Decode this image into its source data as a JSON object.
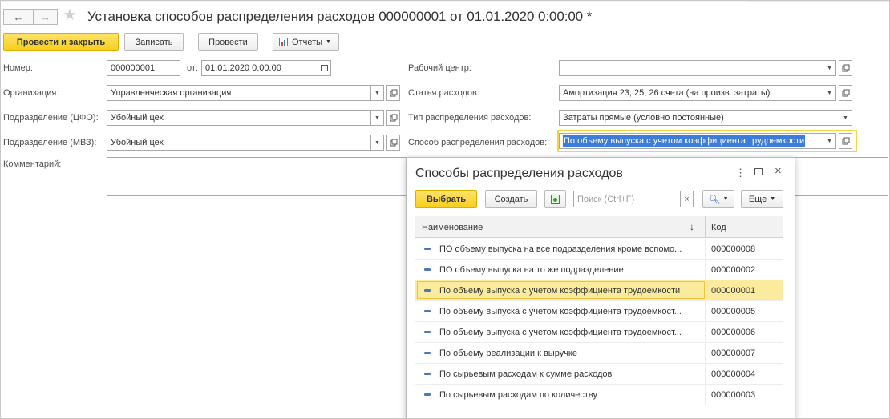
{
  "window": {
    "title": "Установка способов распределения расходов 000000001 от 01.01.2020 0:00:00 *"
  },
  "nav": {
    "back_icon": "←",
    "forward_icon": "→",
    "star_icon": "★"
  },
  "toolbar": {
    "post_close": "Провести и закрыть",
    "save": "Записать",
    "post": "Провести",
    "reports": "Отчеты"
  },
  "form": {
    "number_label": "Номер:",
    "number_value": "000000001",
    "date_label": "от:",
    "date_value": "01.01.2020  0:00:00",
    "org_label": "Организация:",
    "org_value": "Управленческая организация",
    "cfo_label": "Подразделение (ЦФО):",
    "cfo_value": "Убойный цех",
    "mvz_label": "Подразделение (МВЗ):",
    "mvz_value": "Убойный цех",
    "comment_label": "Комментарий:",
    "comment_value": "",
    "workcenter_label": "Рабочий центр:",
    "workcenter_value": "",
    "expense_item_label": "Статья расходов:",
    "expense_item_value": "Амортизация 23, 25, 26 счета (на произв. затраты)",
    "dist_type_label": "Тип распределения расходов:",
    "dist_type_value": "Затраты прямые (условно постоянные)",
    "dist_method_label": "Способ распределения расходов:",
    "dist_method_value": "По объему выпуска с учетом коэффициента трудоемкости"
  },
  "popup": {
    "title": "Способы распределения расходов",
    "select": "Выбрать",
    "create": "Создать",
    "search_placeholder": "Поиск (Ctrl+F)",
    "more": "Еще",
    "col_name": "Наименование",
    "col_code": "Код",
    "rows": [
      {
        "name": "ПО объему выпуска на все подразделения кроме вспомо...",
        "code": "000000008"
      },
      {
        "name": "ПО объему выпуска на то же подразделение",
        "code": "000000002"
      },
      {
        "name": "По объему выпуска с учетом коэффициента трудоемкости",
        "code": "000000001"
      },
      {
        "name": "По объему выпуска с учетом коэффициента трудоемкост...",
        "code": "000000005"
      },
      {
        "name": "По объему выпуска с учетом коэффициента трудоемкост...",
        "code": "000000006"
      },
      {
        "name": "По объему реализации к выручке",
        "code": "000000007"
      },
      {
        "name": "По сырьевым расходам к сумме расходов",
        "code": "000000004"
      },
      {
        "name": "По сырьевым расходам по количеству",
        "code": "000000003"
      }
    ]
  },
  "colors": {
    "accent": "#f6cf1c",
    "selection": "#3b7dd8",
    "row_highlight": "#fbeb9e"
  }
}
